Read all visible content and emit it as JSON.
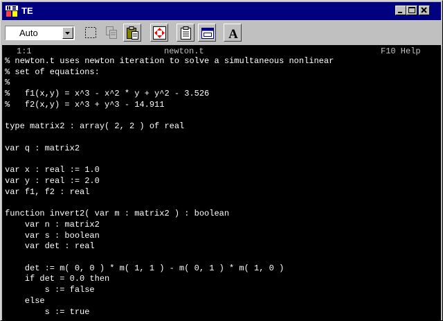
{
  "window": {
    "title": "TE"
  },
  "toolbar": {
    "mode_value": "Auto"
  },
  "editor": {
    "position": "1:1",
    "filename": "newton.t",
    "help_hint": "F10 Help",
    "lines": [
      "% newton.t uses newton iteration to solve a simultaneous nonlinear",
      "% set of equations:",
      "%",
      "%   f1(x,y) = x^3 - x^2 * y + y^2 - 3.526",
      "%   f2(x,y) = x^3 + y^3 - 14.911",
      "",
      "type matrix2 : array( 2, 2 ) of real",
      "",
      "var q : matrix2",
      "",
      "var x : real := 1.0",
      "var y : real := 2.0",
      "var f1, f2 : real",
      "",
      "function invert2( var m : matrix2 ) : boolean",
      "    var n : matrix2",
      "    var s : boolean",
      "    var det : real",
      "",
      "    det := m( 0, 0 ) * m( 1, 1 ) - m( 0, 1 ) * m( 1, 0 )",
      "    if det = 0.0 then",
      "        s := false",
      "    else",
      "        s := true"
    ]
  }
}
